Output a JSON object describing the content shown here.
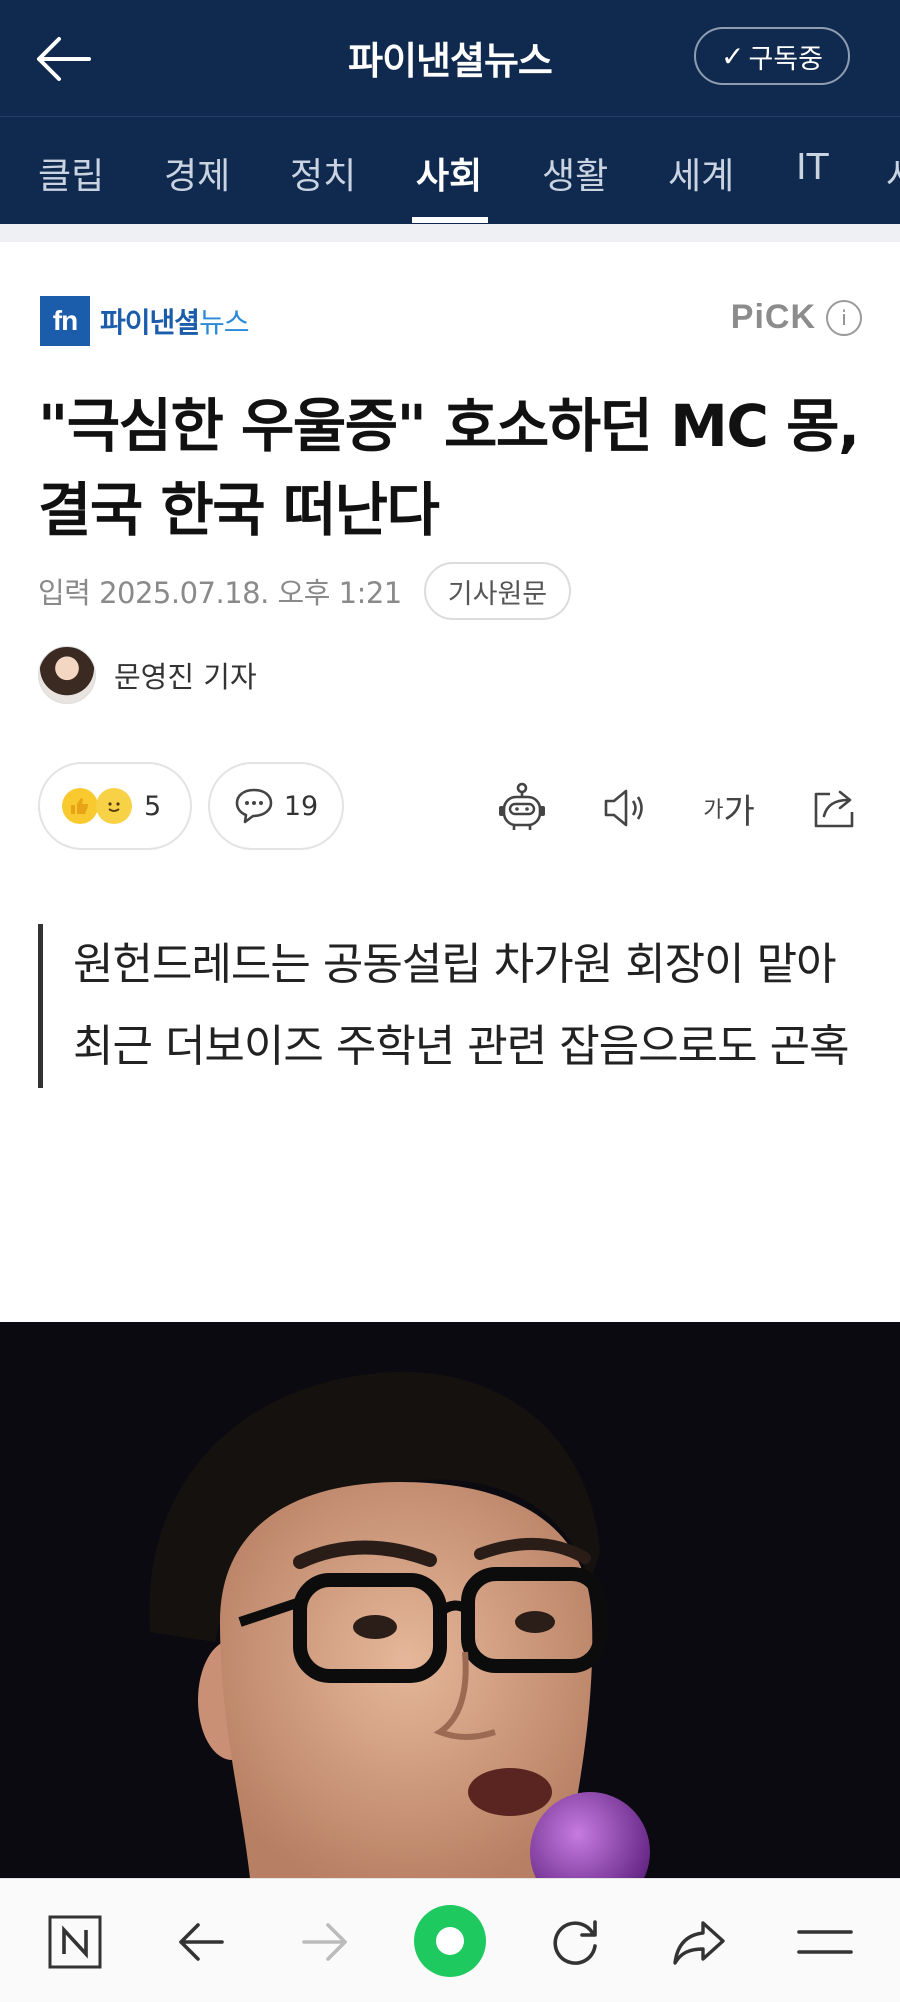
{
  "header": {
    "title": "파이낸셜뉴스",
    "subscribe_label": "구독중",
    "subscribe_check": "✓"
  },
  "categories": {
    "tabs": [
      {
        "label": "클립"
      },
      {
        "label": "경제"
      },
      {
        "label": "정치"
      },
      {
        "label": "사회"
      },
      {
        "label": "생활"
      },
      {
        "label": "세계"
      },
      {
        "label": "IT"
      },
      {
        "label": "사"
      }
    ],
    "active_tab": "사회"
  },
  "article": {
    "press_logo_mark": "fn",
    "press_name": "파이낸셜",
    "press_name_suffix": "뉴스",
    "pick_label": "PiCK",
    "pick_info": "i",
    "headline": "\"극심한 우울증\" 호소하던 MC 몽, 결국 한국 떠난다",
    "date": "입력 2025.07.18. 오후 1:21",
    "original_link_label": "기사원문",
    "author": "문영진 기자",
    "reaction_count": "5",
    "comment_count": "19",
    "font_size_small": "가",
    "font_size_large": "가",
    "summary_lines": [
      "원헌드레드는 공동설립 차가원 회장이 맡아",
      "최근 더보이즈 주학년 관련 잡음으로도 곤혹"
    ]
  },
  "icons": {
    "back": "arrow-left-icon",
    "robot": "robot-icon",
    "speaker": "speaker-icon",
    "share": "share-icon",
    "comment": "comment-icon"
  },
  "colors": {
    "header_bg": "#102a4f",
    "press_blue": "#1b5cab",
    "green_button": "#1ec95f"
  }
}
